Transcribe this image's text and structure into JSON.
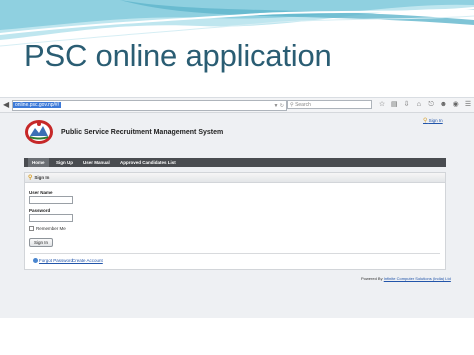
{
  "slide": {
    "title": "PSC online application"
  },
  "browser": {
    "url": "online.psc.gov.np/#/",
    "search_placeholder": "Search",
    "icons": [
      "star-icon",
      "reading-list-icon",
      "download-icon",
      "home-icon",
      "shield-icon",
      "smiley-icon",
      "pocket-icon",
      "menu-icon"
    ]
  },
  "site": {
    "sign_in_link": "Sign In",
    "title": "Public Service Recruitment Management System",
    "menu": [
      "Home",
      "Sign Up",
      "User Manual",
      "Approved Candidates List"
    ]
  },
  "signin_panel": {
    "header": "Sign In",
    "username_label": "User Name",
    "password_label": "Password",
    "remember_label": "Remember Me",
    "submit_label": "Sign In",
    "forgot_link": "Forgot Password",
    "create_link": "Create Account"
  },
  "footer": {
    "powered_prefix": "Powered By",
    "company": "Infinite Computer Solutions (India) Ltd"
  },
  "colors": {
    "slide_title": "#2a5d73",
    "menu_bar": "#494c50",
    "link": "#2255aa",
    "url_highlight": "#3d7ad8"
  }
}
